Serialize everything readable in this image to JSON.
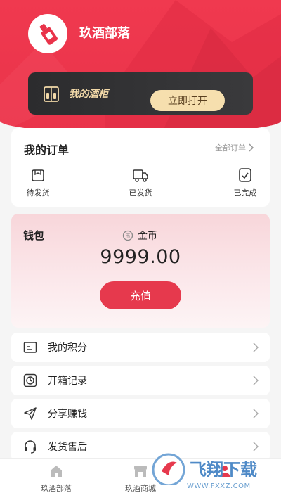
{
  "header": {
    "app_title": "玖酒部落"
  },
  "cabinet": {
    "label": "我的酒柜",
    "open_button": "立即打开"
  },
  "orders": {
    "title": "我的订单",
    "all_link": "全部订单",
    "items": [
      {
        "label": "待发货",
        "icon": "pending-shipment-icon"
      },
      {
        "label": "已发货",
        "icon": "shipped-truck-icon"
      },
      {
        "label": "已完成",
        "icon": "completed-icon"
      }
    ]
  },
  "wallet": {
    "label": "钱包",
    "currency": "金币",
    "amount": "9999.00",
    "recharge_button": "充值"
  },
  "menu": [
    {
      "label": "我的积分",
      "icon": "points-card-icon"
    },
    {
      "label": "开箱记录",
      "icon": "clock-record-icon"
    },
    {
      "label": "分享赚钱",
      "icon": "share-plane-icon"
    },
    {
      "label": "发货售后",
      "icon": "headset-service-icon"
    }
  ],
  "tabbar": [
    {
      "label": "玖酒部落",
      "icon": "home-icon"
    },
    {
      "label": "玖酒商城",
      "icon": "shop-icon"
    },
    {
      "label": "",
      "icon": "profile-icon"
    }
  ],
  "watermark": {
    "text": "飞翔下载",
    "site": "WWW.FXXZ.COM"
  },
  "colors": {
    "brand_red": "#e9334a",
    "gold": "#f6dfae",
    "dark": "#2c2c2e"
  }
}
